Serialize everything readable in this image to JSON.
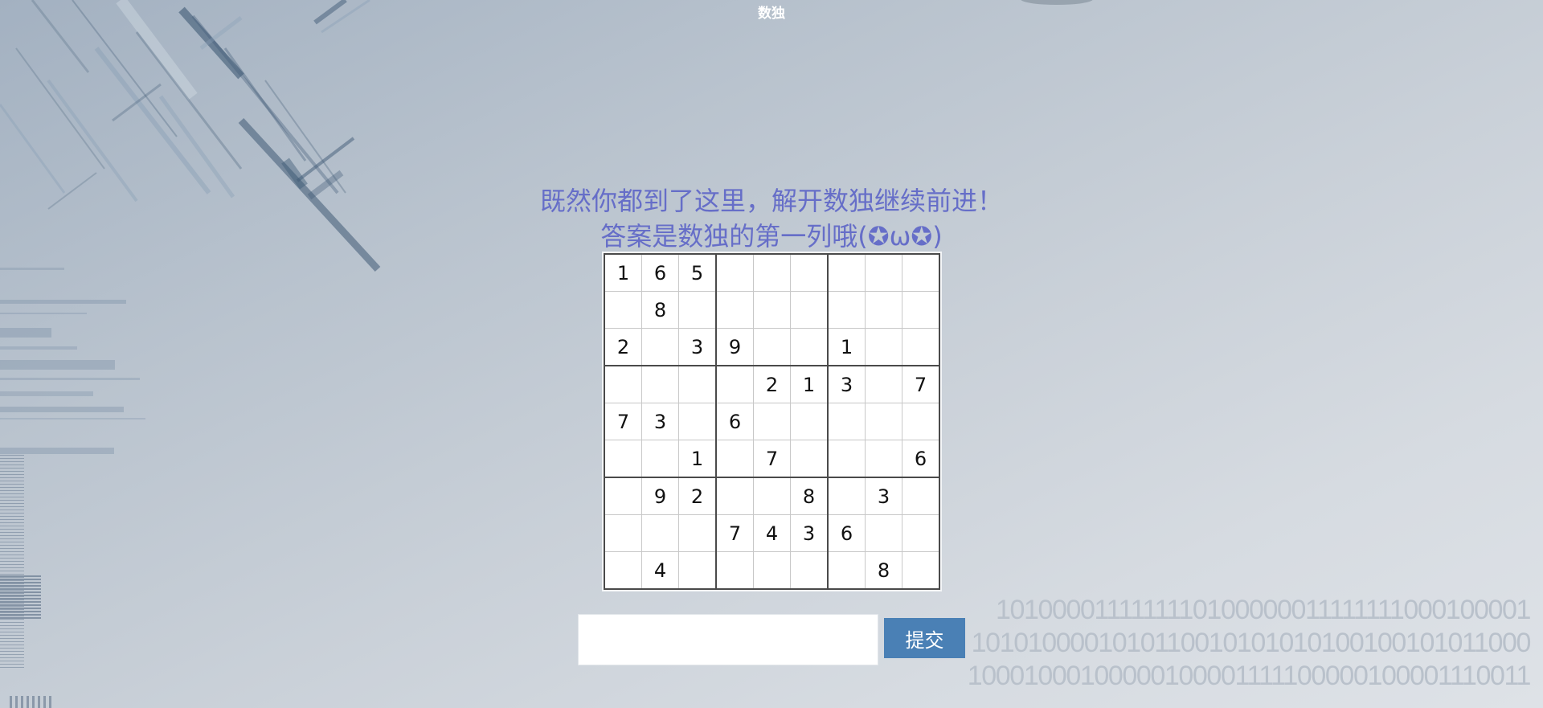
{
  "page": {
    "title": "数独"
  },
  "intro": {
    "line1": "既然你都到了这里，解开数独继续前进！",
    "line2": "答案是数独的第一列哦(✪ω✪)"
  },
  "sudoku": {
    "rows": [
      [
        1,
        6,
        5,
        null,
        null,
        null,
        null,
        null,
        null
      ],
      [
        null,
        8,
        null,
        null,
        null,
        null,
        null,
        null,
        null
      ],
      [
        2,
        null,
        3,
        9,
        null,
        null,
        1,
        null,
        null
      ],
      [
        null,
        null,
        null,
        null,
        2,
        1,
        3,
        null,
        7
      ],
      [
        7,
        3,
        null,
        6,
        null,
        null,
        null,
        null,
        null
      ],
      [
        null,
        null,
        1,
        null,
        7,
        null,
        null,
        null,
        6
      ],
      [
        null,
        9,
        2,
        null,
        null,
        8,
        null,
        3,
        null
      ],
      [
        null,
        null,
        null,
        7,
        4,
        3,
        6,
        null,
        null
      ],
      [
        null,
        4,
        null,
        null,
        null,
        null,
        null,
        8,
        null
      ]
    ]
  },
  "answer_form": {
    "input_value": "",
    "submit_label": "提交"
  },
  "background": {
    "binary_lines": [
      "1010000111111110100000011111111000100001",
      "1010100001010110010101010100100101011000",
      "10001000100000100001111100000100001110011"
    ]
  },
  "colors": {
    "intro_text": "#666ec8",
    "submit_button": "#4a80b5",
    "grid_thick_line": "#4a4a4a",
    "grid_thin_line": "#c8c8c8"
  }
}
